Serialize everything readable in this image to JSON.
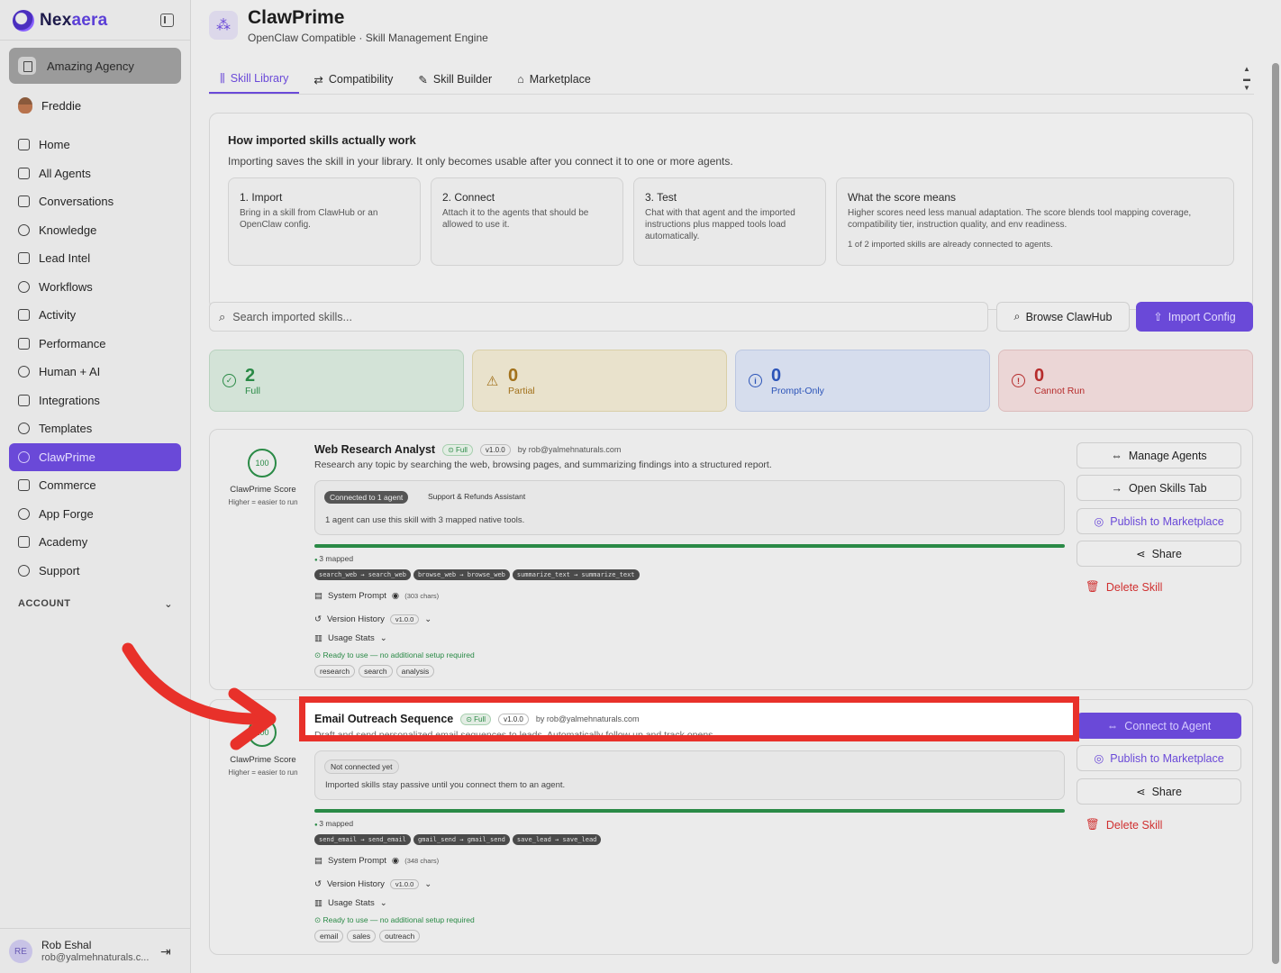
{
  "brand": {
    "name_prefix": "Nex",
    "name_accent": "aera"
  },
  "sidebar": {
    "agency": "Amazing Agency",
    "user": "Freddie",
    "items": [
      {
        "label": "Home",
        "icon": "home-icon"
      },
      {
        "label": "All Agents",
        "icon": "robot-icon"
      },
      {
        "label": "Conversations",
        "icon": "chat-icon"
      },
      {
        "label": "Knowledge",
        "icon": "brain-icon"
      },
      {
        "label": "Lead Intel",
        "icon": "contact-icon"
      },
      {
        "label": "Workflows",
        "icon": "workflow-icon"
      },
      {
        "label": "Activity",
        "icon": "activity-icon"
      },
      {
        "label": "Performance",
        "icon": "trending-icon"
      },
      {
        "label": "Human + AI",
        "icon": "people-icon"
      },
      {
        "label": "Integrations",
        "icon": "plug-icon"
      },
      {
        "label": "Templates",
        "icon": "share-icon"
      },
      {
        "label": "ClawPrime",
        "icon": "cluster-icon",
        "active": true
      },
      {
        "label": "Commerce",
        "icon": "cart-icon"
      },
      {
        "label": "App Forge",
        "icon": "sparkle-icon"
      },
      {
        "label": "Academy",
        "icon": "graduation-icon"
      },
      {
        "label": "Support",
        "icon": "lifebuoy-icon"
      }
    ],
    "account_label": "ACCOUNT",
    "footer": {
      "initials": "RE",
      "name": "Rob Eshal",
      "email": "rob@yalmehnaturals.c..."
    }
  },
  "header": {
    "title": "ClawPrime",
    "subtitle": "OpenClaw Compatible · Skill Management Engine"
  },
  "tabs": [
    {
      "label": "Skill Library",
      "active": true
    },
    {
      "label": "Compatibility"
    },
    {
      "label": "Skill Builder"
    },
    {
      "label": "Marketplace"
    }
  ],
  "info": {
    "title": "How imported skills actually work",
    "desc": "Importing saves the skill in your library. It only becomes usable after you connect it to one or more agents.",
    "steps": [
      {
        "title": "1. Import",
        "desc": "Bring in a skill from ClawHub or an OpenClaw config."
      },
      {
        "title": "2. Connect",
        "desc": "Attach it to the agents that should be allowed to use it."
      },
      {
        "title": "3. Test",
        "desc": "Chat with that agent and the imported instructions plus mapped tools load automatically."
      },
      {
        "title": "What the score means",
        "desc": "Higher scores need less manual adaptation. The score blends tool mapping coverage, compatibility tier, instruction quality, and env readiness.",
        "note": "1 of 2 imported skills are already connected to agents."
      }
    ]
  },
  "search": {
    "placeholder": "Search imported skills..."
  },
  "buttons": {
    "browse": "Browse ClawHub",
    "import": "Import Config"
  },
  "stats": [
    {
      "value": "2",
      "label": "Full"
    },
    {
      "value": "0",
      "label": "Partial"
    },
    {
      "value": "0",
      "label": "Prompt-Only"
    },
    {
      "value": "0",
      "label": "Cannot Run"
    }
  ],
  "skills": [
    {
      "score": "100",
      "score_label": "ClawPrime Score",
      "score_sub": "Higher = easier to run",
      "name": "Web Research Analyst",
      "tier": "Full",
      "version": "v1.0.0",
      "author": "by rob@yalmehnaturals.com",
      "desc": "Research any topic by searching the web, browsing pages, and summarizing findings into a structured report.",
      "conn_badge": "Connected to 1 agent",
      "conn_agent": "Support & Refunds Assistant",
      "conn_text": "1 agent can use this skill with 3 mapped native tools.",
      "mapped": "3 mapped",
      "chips": [
        "search_web → search_web",
        "browse_web → browse_web",
        "summarize_text → summarize_text"
      ],
      "system_prompt": "System Prompt",
      "prompt_chars": "(303 chars)",
      "version_history": "Version History",
      "usage_stats": "Usage Stats",
      "ready": "Ready to use — no additional setup required",
      "tags": [
        "research",
        "search",
        "analysis"
      ],
      "actions": [
        "Manage Agents",
        "Open Skills Tab",
        "Publish to Marketplace",
        "Share",
        "Delete Skill"
      ]
    },
    {
      "score": "100",
      "score_label": "ClawPrime Score",
      "score_sub": "Higher = easier to run",
      "name": "Email Outreach Sequence",
      "tier": "Full",
      "version": "v1.0.0",
      "author": "by rob@yalmehnaturals.com",
      "desc": "Draft and send personalized email sequences to leads. Automatically follow up and track opens.",
      "conn_badge": "Not connected yet",
      "conn_text": "Imported skills stay passive until you connect them to an agent.",
      "mapped": "3 mapped",
      "chips": [
        "send_email → send_email",
        "gmail_send → gmail_send",
        "save_lead → save_lead"
      ],
      "system_prompt": "System Prompt",
      "prompt_chars": "(348 chars)",
      "version_history": "Version History",
      "usage_stats": "Usage Stats",
      "ready": "Ready to use — no additional setup required",
      "tags": [
        "email",
        "sales",
        "outreach"
      ],
      "actions": [
        "Connect to Agent",
        "Publish to Marketplace",
        "Share",
        "Delete Skill"
      ]
    }
  ],
  "colors": {
    "accent": "#6a49d8",
    "success": "#2a8a46",
    "danger": "#d03030",
    "highlight": "#e8312a"
  }
}
